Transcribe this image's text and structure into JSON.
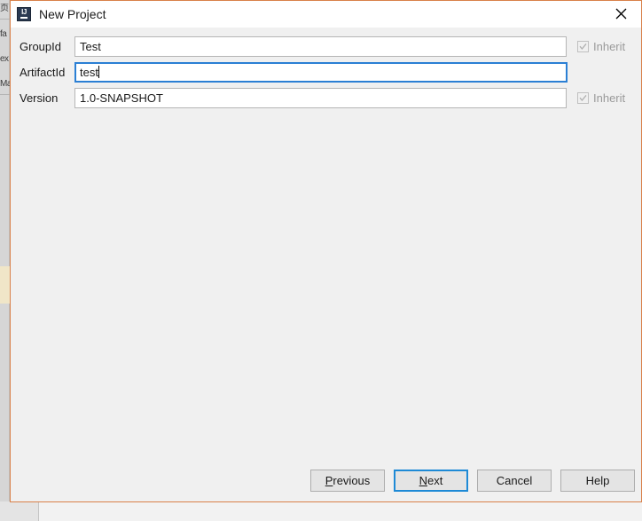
{
  "background": {
    "tool_labels": [
      "页",
      "fa",
      "ex",
      "Ma"
    ],
    "highlight_color": "#f0e6c8"
  },
  "dialog": {
    "title": "New Project",
    "app_icon": "intellij-idea-icon",
    "close_icon": "close-icon",
    "border_color": "#d9814a",
    "background_color": "#f0f0f0"
  },
  "form": {
    "rows": [
      {
        "label": "GroupId",
        "value": "Test",
        "placeholder": "",
        "focused": false,
        "inherit": {
          "label": "Inherit",
          "checked": true,
          "enabled": false
        }
      },
      {
        "label": "ArtifactId",
        "value": "test",
        "placeholder": "",
        "focused": true,
        "inherit": null
      },
      {
        "label": "Version",
        "value": "1.0-SNAPSHOT",
        "placeholder": "",
        "focused": false,
        "inherit": {
          "label": "Inherit",
          "checked": true,
          "enabled": false
        }
      }
    ]
  },
  "buttons": {
    "previous": {
      "prefix": "",
      "mnemonic": "P",
      "suffix": "revious"
    },
    "next": {
      "prefix": "",
      "mnemonic": "N",
      "suffix": "ext"
    },
    "cancel": {
      "prefix": "",
      "mnemonic": "",
      "suffix": "Cancel"
    },
    "help": {
      "prefix": "",
      "mnemonic": "",
      "suffix": "Help"
    },
    "default_button": "next",
    "focus_color": "#1e8ad6"
  }
}
